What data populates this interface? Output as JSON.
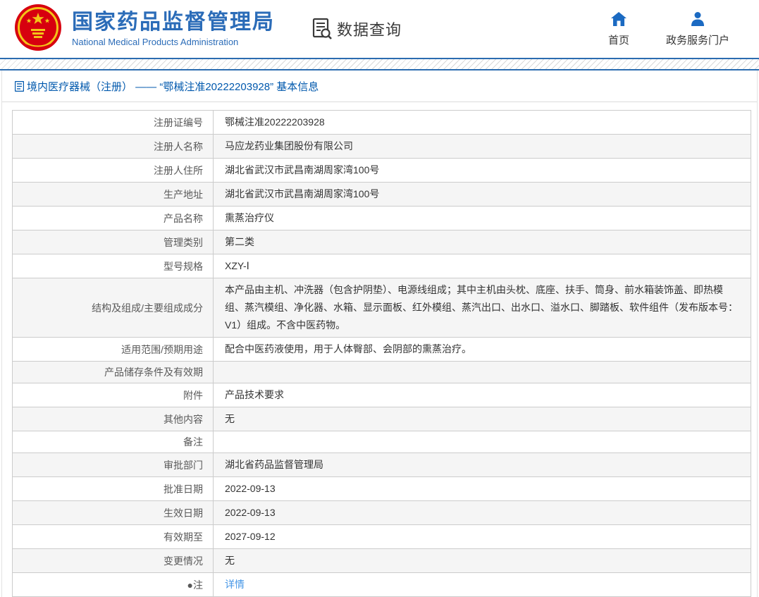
{
  "header": {
    "brand": {
      "title": "国家药品监督管理局",
      "subtitle": "National Medical Products Administration",
      "emblem_icon": "china-national-emblem"
    },
    "data_query": {
      "label": "数据查询",
      "icon": "document-search-icon"
    },
    "nav": [
      {
        "label": "首页",
        "icon": "home-icon"
      },
      {
        "label": "政务服务门户",
        "icon": "user-icon"
      }
    ]
  },
  "breadcrumb": {
    "icon": "document-list-icon",
    "text": "境内医疗器械（注册） —— “鄂械注准20222203928” 基本信息"
  },
  "table": {
    "rows": [
      {
        "label": "注册证编号",
        "value": "鄂械注准20222203928"
      },
      {
        "label": "注册人名称",
        "value": "马应龙药业集团股份有限公司"
      },
      {
        "label": "注册人住所",
        "value": "湖北省武汉市武昌南湖周家湾100号"
      },
      {
        "label": "生产地址",
        "value": "湖北省武汉市武昌南湖周家湾100号"
      },
      {
        "label": "产品名称",
        "value": "熏蒸治疗仪"
      },
      {
        "label": "管理类别",
        "value": "第二类"
      },
      {
        "label": "型号规格",
        "value": "XZY-Ⅰ"
      },
      {
        "label": "结构及组成/主要组成成分",
        "value": "本产品由主机、冲洗器（包含护阴垫）、电源线组成；其中主机由头枕、底座、扶手、筒身、前水箱装饰盖、即热模组、蒸汽模组、净化器、水箱、显示面板、红外模组、蒸汽出口、出水口、溢水口、脚踏板、软件组件（发布版本号：V1）组成。不含中医药物。"
      },
      {
        "label": "适用范围/预期用途",
        "value": "配合中医药液使用，用于人体臀部、会阴部的熏蒸治疗。"
      },
      {
        "label": "产品储存条件及有效期",
        "value": ""
      },
      {
        "label": "附件",
        "value": "产品技术要求"
      },
      {
        "label": "其他内容",
        "value": "无"
      },
      {
        "label": "备注",
        "value": ""
      },
      {
        "label": "审批部门",
        "value": "湖北省药品监督管理局"
      },
      {
        "label": "批准日期",
        "value": "2022-09-13"
      },
      {
        "label": "生效日期",
        "value": "2022-09-13"
      },
      {
        "label": "有效期至",
        "value": "2027-09-12"
      },
      {
        "label": "变更情况",
        "value": "无"
      },
      {
        "label": "●注",
        "value": "详情"
      }
    ]
  },
  "colors": {
    "accent_blue": "#2b6cb0",
    "brand_blue": "#2b6cb8",
    "breadcrumb_blue": "#0058ad",
    "link_blue": "#4596e6",
    "emblem_red": "#d7000f",
    "emblem_gold": "#f3c418",
    "row_alt_bg": "#f5f5f5",
    "table_border": "#cccccc"
  }
}
